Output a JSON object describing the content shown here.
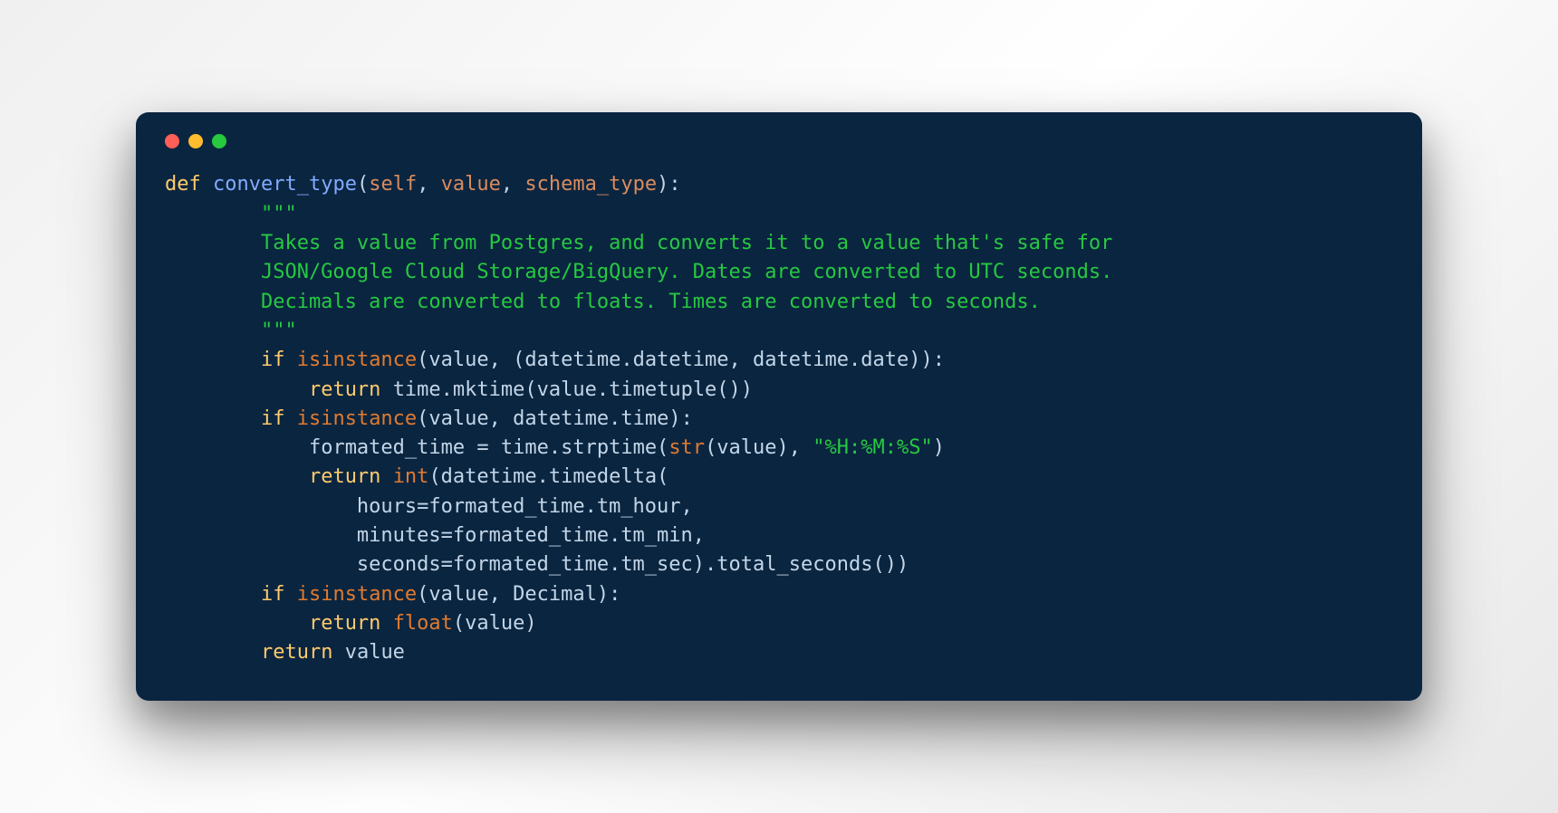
{
  "window": {
    "dots": [
      "red",
      "yellow",
      "green"
    ]
  },
  "code": {
    "line1": {
      "kw": "def",
      "fn": "convert_type",
      "p_open": "(",
      "self": "self",
      "c1": ", ",
      "p1": "value",
      "c2": ", ",
      "p2": "schema_type",
      "close": "):"
    },
    "doc_open": "        \"\"\"",
    "doc_l1": "        Takes a value from Postgres, and converts it to a value that's safe for",
    "doc_l2": "        JSON/Google Cloud Storage/BigQuery. Dates are converted to UTC seconds.",
    "doc_l3": "        Decimals are converted to floats. Times are converted to seconds.",
    "doc_close": "        \"\"\"",
    "l7": {
      "indent": "        ",
      "kw": "if",
      "sp": " ",
      "bi": "isinstance",
      "rest1": "(value, (datetime.datetime, datetime.date)):"
    },
    "l8": {
      "indent": "            ",
      "kw": "return",
      "sp": " ",
      "rest": "time.mktime(value.timetuple())"
    },
    "l9": {
      "indent": "        ",
      "kw": "if",
      "sp": " ",
      "bi": "isinstance",
      "rest": "(value, datetime.time):"
    },
    "l10": {
      "indent": "            ",
      "lhs": "formated_time = time.strptime(",
      "bi": "str",
      "mid": "(value), ",
      "str": "\"%H:%M:%S\"",
      "end": ")"
    },
    "l11": {
      "indent": "            ",
      "kw": "return",
      "sp": " ",
      "bi": "int",
      "rest": "(datetime.timedelta("
    },
    "l12": "                hours=formated_time.tm_hour,",
    "l13": "                minutes=formated_time.tm_min,",
    "l14": "                seconds=formated_time.tm_sec).total_seconds())",
    "l15": {
      "indent": "        ",
      "kw": "if",
      "sp": " ",
      "bi": "isinstance",
      "rest": "(value, Decimal):"
    },
    "l16": {
      "indent": "            ",
      "kw": "return",
      "sp": " ",
      "bi": "float",
      "rest": "(value)"
    },
    "l17": {
      "indent": "        ",
      "kw": "return",
      "sp": " ",
      "rest": "value"
    }
  }
}
